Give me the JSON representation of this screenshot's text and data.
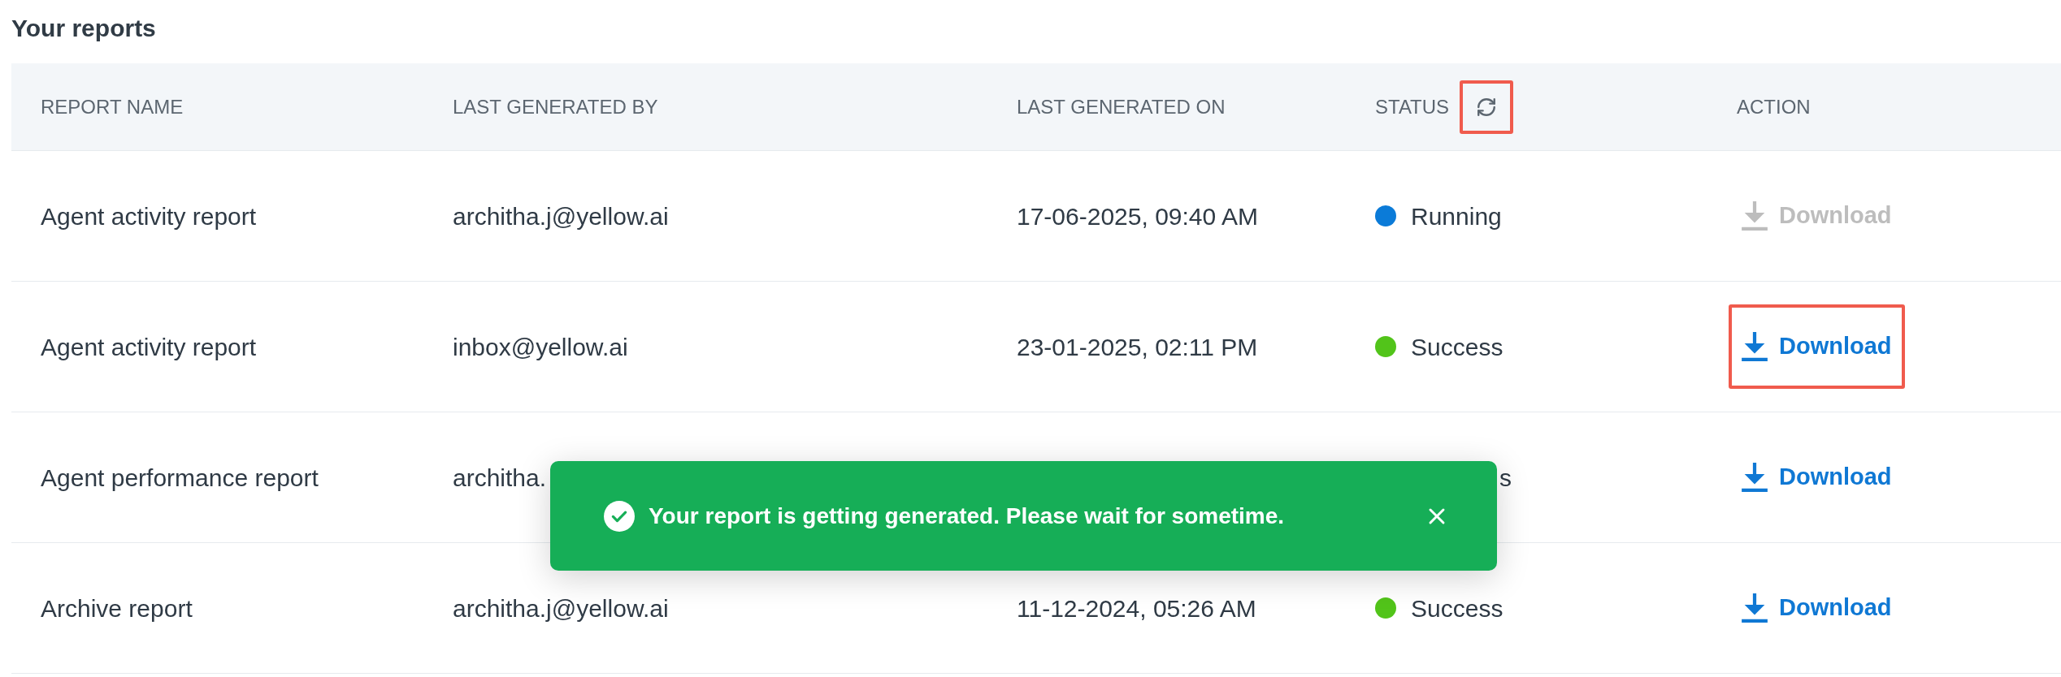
{
  "title": "Your reports",
  "table": {
    "columns": [
      {
        "label": "REPORT NAME"
      },
      {
        "label": "LAST GENERATED BY"
      },
      {
        "label": "LAST GENERATED ON"
      },
      {
        "label": "STATUS",
        "refresh_button": {
          "highlighted": true
        }
      },
      {
        "label": "ACTION"
      }
    ],
    "rows": [
      {
        "name": "Agent activity report",
        "generated_by": "architha.j@yellow.ai",
        "generated_on": "17-06-2025, 09:40 AM",
        "status": {
          "label": "Running",
          "color": "#0b7bd8"
        },
        "action": {
          "label": "Download",
          "disabled": true,
          "highlighted": false
        }
      },
      {
        "name": "Agent activity report",
        "generated_by": "inbox@yellow.ai",
        "generated_on": "23-01-2025, 02:11 PM",
        "status": {
          "label": "Success",
          "color": "#52c41a"
        },
        "action": {
          "label": "Download",
          "disabled": false,
          "highlighted": true
        }
      },
      {
        "name": "Agent performance report",
        "generated_by": "architha.",
        "status": {
          "label": "s"
        },
        "action": {
          "label": "Download",
          "disabled": false,
          "highlighted": false
        }
      },
      {
        "name": "Archive report",
        "generated_by": "architha.j@yellow.ai",
        "generated_on": "11-12-2024, 05:26 AM",
        "status": {
          "label": "Success",
          "color": "#52c41a"
        },
        "action": {
          "label": "Download",
          "disabled": false,
          "highlighted": false
        }
      }
    ]
  },
  "toast": {
    "message": "Your report is getting generated. Please wait for sometime."
  }
}
